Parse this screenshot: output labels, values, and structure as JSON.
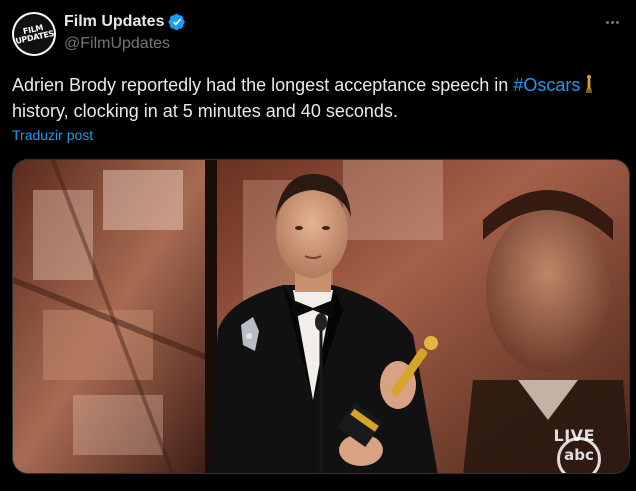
{
  "post": {
    "author": {
      "display_name": "Film Updates",
      "handle": "@FilmUpdates",
      "verified": true,
      "avatar_text": "FILM\nUPDATES"
    },
    "text_before": "Adrien Brody reportedly had the longest acceptance speech in ",
    "hashtag": "#Oscars",
    "text_after": " history, clocking in at 5 minutes and 40 seconds.",
    "translate_label": "Traduzir post",
    "media": {
      "live_label": "LIVE",
      "network_logo": "abc"
    }
  },
  "colors": {
    "background": "#000000",
    "text": "#e7e9ea",
    "secondary_text": "#71767b",
    "link": "#1d9bf0",
    "verified_badge": "#1d9bf0"
  },
  "icons": {
    "verified": "verified-badge-icon",
    "more": "more-options-icon",
    "oscar": "oscar-statuette-emoji"
  }
}
